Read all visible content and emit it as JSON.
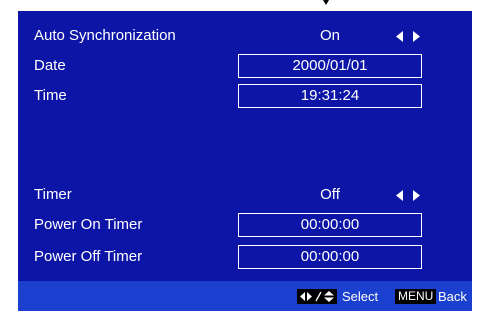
{
  "settings": {
    "auto_sync": {
      "label": "Auto Synchronization",
      "value": "On"
    },
    "date": {
      "label": "Date",
      "value": "2000/01/01"
    },
    "time": {
      "label": "Time",
      "value": "19:31:24"
    },
    "timer": {
      "label": "Timer",
      "value": "Off"
    },
    "power_on_timer": {
      "label": "Power On Timer",
      "value": "00:00:00"
    },
    "power_off_timer": {
      "label": "Power Off Timer",
      "value": "00:00:00"
    }
  },
  "footer": {
    "select_label": "Select",
    "menu_key": "MENU",
    "back_label": "Back"
  },
  "icons": {
    "left_right": "left-right-arrows-icon",
    "nav_keys": "arrow-keys-icon"
  },
  "colors": {
    "panel": "#0d15a6",
    "footer": "#1b3fcf",
    "text": "#ffffff"
  }
}
